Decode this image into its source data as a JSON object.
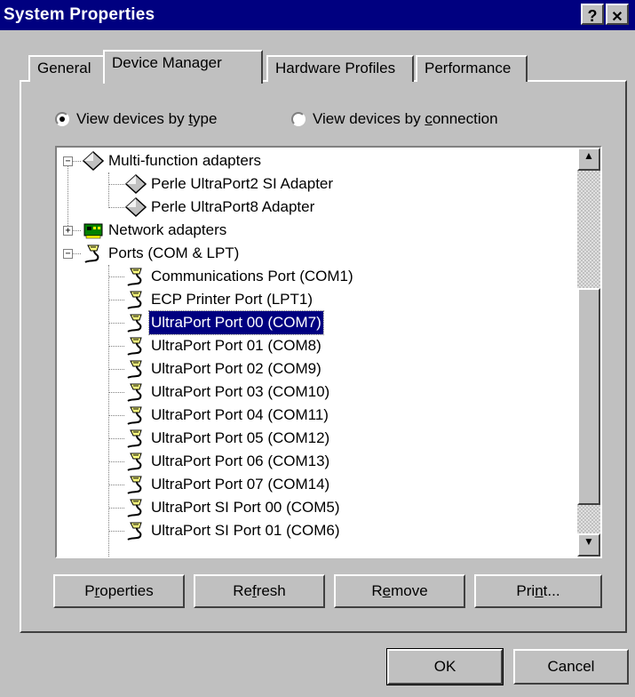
{
  "window": {
    "title": "System Properties",
    "help_label": "?",
    "close_label": "✕"
  },
  "tabs": [
    {
      "label": "General",
      "active": false
    },
    {
      "label": "Device Manager",
      "active": true
    },
    {
      "label": "Hardware Profiles",
      "active": false
    },
    {
      "label": "Performance",
      "active": false
    }
  ],
  "view": {
    "by_type_pre": "View devices by ",
    "by_type_key": "t",
    "by_type_post": "ype",
    "by_connection_pre": "View devices by ",
    "by_connection_key": "c",
    "by_connection_post": "onnection",
    "selected": "by_type"
  },
  "tree": [
    {
      "label": "Multi-function adapters",
      "icon": "diamond-icon",
      "expander": "−"
    },
    {
      "label": "Perle UltraPort2 SI Adapter",
      "icon": "diamond-icon"
    },
    {
      "label": "Perle UltraPort8 Adapter",
      "icon": "diamond-icon"
    },
    {
      "label": "Network adapters",
      "icon": "network-card-icon",
      "expander": "+"
    },
    {
      "label": "Ports (COM & LPT)",
      "icon": "port-plug-icon",
      "expander": "−"
    },
    {
      "label": "Communications Port (COM1)",
      "icon": "port-plug-icon"
    },
    {
      "label": "ECP Printer Port (LPT1)",
      "icon": "port-plug-icon"
    },
    {
      "label": "UltraPort Port 00 (COM7)",
      "icon": "port-plug-icon",
      "selected": true
    },
    {
      "label": "UltraPort Port 01 (COM8)",
      "icon": "port-plug-icon"
    },
    {
      "label": "UltraPort Port 02 (COM9)",
      "icon": "port-plug-icon"
    },
    {
      "label": "UltraPort Port 03 (COM10)",
      "icon": "port-plug-icon"
    },
    {
      "label": "UltraPort Port 04 (COM11)",
      "icon": "port-plug-icon"
    },
    {
      "label": "UltraPort Port 05 (COM12)",
      "icon": "port-plug-icon"
    },
    {
      "label": "UltraPort Port 06 (COM13)",
      "icon": "port-plug-icon"
    },
    {
      "label": "UltraPort Port 07 (COM14)",
      "icon": "port-plug-icon"
    },
    {
      "label": "UltraPort SI Port 00 (COM5)",
      "icon": "port-plug-icon"
    },
    {
      "label": "UltraPort SI Port 01 (COM6)",
      "icon": "port-plug-icon"
    }
  ],
  "actions": {
    "properties_pre": "P",
    "properties_key": "r",
    "properties_post": "operties",
    "refresh_pre": "Re",
    "refresh_key": "f",
    "refresh_post": "resh",
    "remove_pre": "R",
    "remove_key": "e",
    "remove_post": "move",
    "print_pre": "Pri",
    "print_key": "n",
    "print_post": "t..."
  },
  "dialog": {
    "ok_label": "OK",
    "cancel_label": "Cancel"
  },
  "colors": {
    "titlebar": "#000080",
    "face": "#c0c0c0",
    "selection": "#000080"
  }
}
